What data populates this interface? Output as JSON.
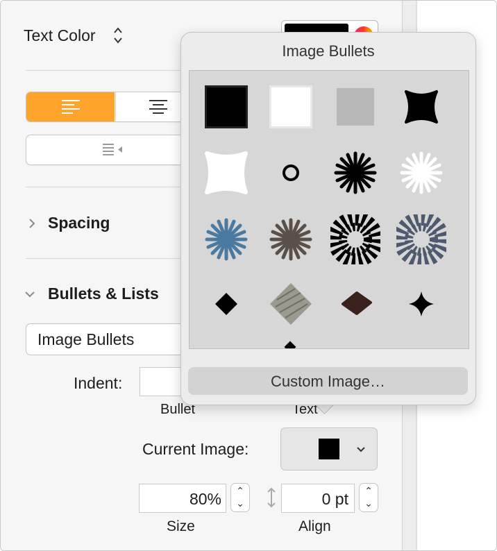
{
  "inspector": {
    "text_color_label": "Text Color",
    "text_color_stepper": "⌃⌄",
    "alignment": {
      "left_icon": "align-left-icon",
      "center_icon": "align-center-icon",
      "accent": "#ffa42b"
    },
    "spacing_label": "Spacing",
    "bullets_section_label": "Bullets & Lists",
    "bullet_style_value": "Image Bullets",
    "indent_label": "Indent:",
    "bullet_sublabel": "Bullet",
    "text_sublabel": "Text",
    "current_image_label": "Current Image:",
    "size_value": "80%",
    "size_label": "Size",
    "align_value": "0 pt",
    "align_label": "Align"
  },
  "popover": {
    "title": "Image Bullets",
    "custom_button": "Custom Image…",
    "bullets": [
      "black-square",
      "white-square",
      "gray-square",
      "black-rounded-star",
      "white-rounded-star",
      "hollow-circle",
      "black-starburst",
      "white-starburst",
      "blue-starburst",
      "brown-starburst",
      "black-sunburst",
      "slate-sunburst",
      "black-diamond",
      "pencil-diamond",
      "brown-diamond",
      "black-four-point-star"
    ]
  }
}
